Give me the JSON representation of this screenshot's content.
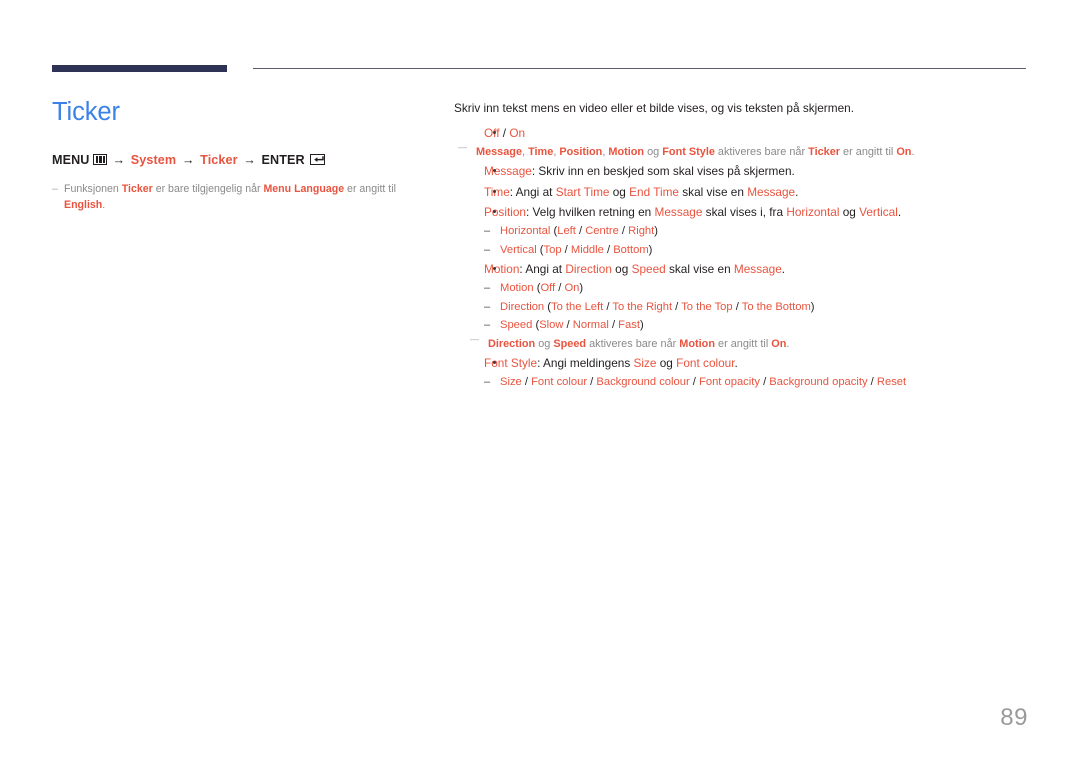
{
  "document": {
    "page_number": "89",
    "title": "Ticker",
    "title_color": "#3b82e8",
    "accent_color": "#e8543f",
    "rule_color": "#2e3254"
  },
  "left": {
    "menu_path": {
      "menu_label": "MENU",
      "menu_icon": "menu-grid-icon",
      "arrow": "→",
      "step1": "System",
      "step2": "Ticker",
      "enter_label": "ENTER",
      "enter_icon": "enter-key-icon"
    },
    "note": {
      "dash": "–",
      "part1": "Funksjonen ",
      "kw1": "Ticker",
      "part2": " er bare tilgjengelig når ",
      "kw2": "Menu Language",
      "part3": " er angitt til ",
      "kw3": "English",
      "part4": "."
    }
  },
  "right": {
    "intro": "Skriv inn tekst mens en video eller et bilde vises, og vis teksten på skjermen.",
    "items": [
      {
        "type": "bullet",
        "segments": [
          {
            "t": "Off",
            "s": "red"
          },
          {
            "t": " / ",
            "s": "plain"
          },
          {
            "t": "On",
            "s": "red"
          }
        ]
      },
      {
        "type": "note",
        "indent": false,
        "segments": [
          {
            "t": "Message",
            "s": "redbold"
          },
          {
            "t": ", ",
            "s": "plain"
          },
          {
            "t": "Time",
            "s": "redbold"
          },
          {
            "t": ", ",
            "s": "plain"
          },
          {
            "t": "Position",
            "s": "redbold"
          },
          {
            "t": ", ",
            "s": "plain"
          },
          {
            "t": "Motion",
            "s": "redbold"
          },
          {
            "t": " og ",
            "s": "plain"
          },
          {
            "t": "Font Style",
            "s": "redbold"
          },
          {
            "t": " aktiveres bare når ",
            "s": "plain"
          },
          {
            "t": "Ticker",
            "s": "redbold"
          },
          {
            "t": " er angitt til ",
            "s": "plain"
          },
          {
            "t": "On",
            "s": "redbold"
          },
          {
            "t": ".",
            "s": "plain"
          }
        ]
      },
      {
        "type": "bullet",
        "segments": [
          {
            "t": "Message",
            "s": "red"
          },
          {
            "t": ": Skriv inn en beskjed som skal vises på skjermen.",
            "s": "plain"
          }
        ]
      },
      {
        "type": "bullet",
        "segments": [
          {
            "t": "Time",
            "s": "red"
          },
          {
            "t": ": Angi at ",
            "s": "plain"
          },
          {
            "t": "Start Time",
            "s": "red"
          },
          {
            "t": " og ",
            "s": "plain"
          },
          {
            "t": "End Time",
            "s": "red"
          },
          {
            "t": " skal vise en ",
            "s": "plain"
          },
          {
            "t": "Message",
            "s": "red"
          },
          {
            "t": ".",
            "s": "plain"
          }
        ]
      },
      {
        "type": "bullet",
        "segments": [
          {
            "t": "Position",
            "s": "red"
          },
          {
            "t": ": Velg hvilken retning en ",
            "s": "plain"
          },
          {
            "t": "Message",
            "s": "red"
          },
          {
            "t": " skal vises i, fra ",
            "s": "plain"
          },
          {
            "t": "Horizontal",
            "s": "red"
          },
          {
            "t": " og ",
            "s": "plain"
          },
          {
            "t": "Vertical",
            "s": "red"
          },
          {
            "t": ".",
            "s": "plain"
          }
        ],
        "children": [
          {
            "segments": [
              {
                "t": "Horizontal",
                "s": "red"
              },
              {
                "t": " (",
                "s": "plain"
              },
              {
                "t": "Left",
                "s": "red"
              },
              {
                "t": " / ",
                "s": "plain"
              },
              {
                "t": "Centre",
                "s": "red"
              },
              {
                "t": " / ",
                "s": "plain"
              },
              {
                "t": "Right",
                "s": "red"
              },
              {
                "t": ")",
                "s": "plain"
              }
            ]
          },
          {
            "segments": [
              {
                "t": "Vertical",
                "s": "red"
              },
              {
                "t": " (",
                "s": "plain"
              },
              {
                "t": "Top",
                "s": "red"
              },
              {
                "t": " / ",
                "s": "plain"
              },
              {
                "t": "Middle",
                "s": "red"
              },
              {
                "t": " / ",
                "s": "plain"
              },
              {
                "t": "Bottom",
                "s": "red"
              },
              {
                "t": ")",
                "s": "plain"
              }
            ]
          }
        ]
      },
      {
        "type": "bullet",
        "segments": [
          {
            "t": "Motion",
            "s": "red"
          },
          {
            "t": ": Angi at ",
            "s": "plain"
          },
          {
            "t": "Direction",
            "s": "red"
          },
          {
            "t": " og ",
            "s": "plain"
          },
          {
            "t": "Speed",
            "s": "red"
          },
          {
            "t": " skal vise en ",
            "s": "plain"
          },
          {
            "t": "Message",
            "s": "red"
          },
          {
            "t": ".",
            "s": "plain"
          }
        ],
        "children": [
          {
            "segments": [
              {
                "t": "Motion",
                "s": "red"
              },
              {
                "t": " (",
                "s": "plain"
              },
              {
                "t": "Off",
                "s": "red"
              },
              {
                "t": " / ",
                "s": "plain"
              },
              {
                "t": "On",
                "s": "red"
              },
              {
                "t": ")",
                "s": "plain"
              }
            ]
          },
          {
            "segments": [
              {
                "t": "Direction",
                "s": "red"
              },
              {
                "t": " (",
                "s": "plain"
              },
              {
                "t": "To the Left",
                "s": "red"
              },
              {
                "t": " / ",
                "s": "plain"
              },
              {
                "t": "To the Right",
                "s": "red"
              },
              {
                "t": " / ",
                "s": "plain"
              },
              {
                "t": "To the Top",
                "s": "red"
              },
              {
                "t": " / ",
                "s": "plain"
              },
              {
                "t": "To the Bottom",
                "s": "red"
              },
              {
                "t": ")",
                "s": "plain"
              }
            ]
          },
          {
            "segments": [
              {
                "t": "Speed",
                "s": "red"
              },
              {
                "t": " (",
                "s": "plain"
              },
              {
                "t": "Slow",
                "s": "red"
              },
              {
                "t": " / ",
                "s": "plain"
              },
              {
                "t": "Normal",
                "s": "red"
              },
              {
                "t": " / ",
                "s": "plain"
              },
              {
                "t": "Fast",
                "s": "red"
              },
              {
                "t": ")",
                "s": "plain"
              }
            ]
          }
        ]
      },
      {
        "type": "note",
        "indent": true,
        "segments": [
          {
            "t": "Direction",
            "s": "redbold"
          },
          {
            "t": " og ",
            "s": "plain"
          },
          {
            "t": "Speed",
            "s": "redbold"
          },
          {
            "t": " aktiveres bare når ",
            "s": "plain"
          },
          {
            "t": "Motion",
            "s": "redbold"
          },
          {
            "t": " er angitt til ",
            "s": "plain"
          },
          {
            "t": "On",
            "s": "redbold"
          },
          {
            "t": ".",
            "s": "plain"
          }
        ]
      },
      {
        "type": "bullet",
        "segments": [
          {
            "t": "Font Style",
            "s": "red"
          },
          {
            "t": ": Angi meldingens ",
            "s": "plain"
          },
          {
            "t": "Size",
            "s": "red"
          },
          {
            "t": " og ",
            "s": "plain"
          },
          {
            "t": "Font colour",
            "s": "red"
          },
          {
            "t": ".",
            "s": "plain"
          }
        ],
        "children": [
          {
            "segments": [
              {
                "t": "Size",
                "s": "red"
              },
              {
                "t": " / ",
                "s": "plain"
              },
              {
                "t": "Font colour",
                "s": "red"
              },
              {
                "t": " / ",
                "s": "plain"
              },
              {
                "t": "Background colour",
                "s": "red"
              },
              {
                "t": " / ",
                "s": "plain"
              },
              {
                "t": "Font opacity",
                "s": "red"
              },
              {
                "t": " / ",
                "s": "plain"
              },
              {
                "t": "Background opacity",
                "s": "red"
              },
              {
                "t": " / ",
                "s": "plain"
              },
              {
                "t": "Reset",
                "s": "red"
              }
            ]
          }
        ]
      }
    ]
  }
}
